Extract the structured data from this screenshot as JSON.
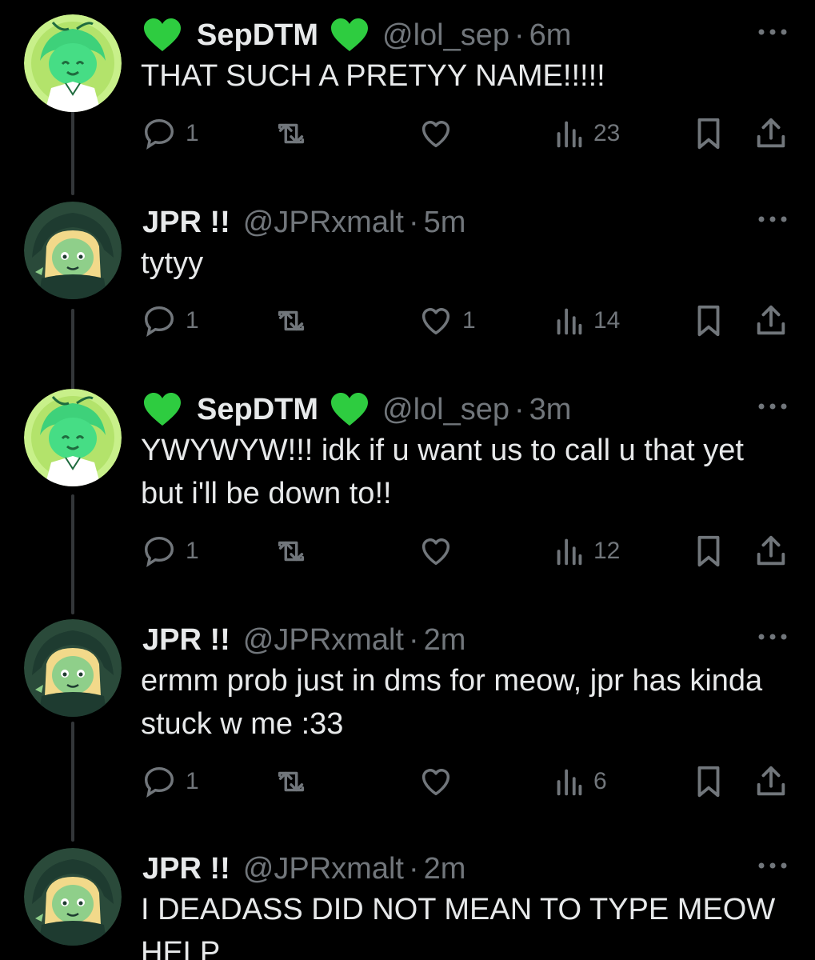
{
  "thread": {
    "tweets": [
      {
        "author": "SepDTM",
        "handle": "@lol_sep",
        "time": "6m",
        "text": "THAT SUCH A PRETYY NAME!!!!!",
        "avatar": "green-character-avatar",
        "name_emoji": "green-heart-icon",
        "replies": "1",
        "retweets": "",
        "likes": "",
        "views": "23"
      },
      {
        "author": "JPR !!",
        "handle": "@JPRxmalt",
        "time": "5m",
        "text": "tytyy",
        "avatar": "hooded-character-avatar",
        "replies": "1",
        "retweets": "",
        "likes": "1",
        "views": "14"
      },
      {
        "author": "SepDTM",
        "handle": "@lol_sep",
        "time": "3m",
        "text": "YWYWYW!!! idk if u want us to call u that yet but i'll be down to!!",
        "avatar": "green-character-avatar",
        "name_emoji": "green-heart-icon",
        "replies": "1",
        "retweets": "",
        "likes": "",
        "views": "12"
      },
      {
        "author": "JPR !!",
        "handle": "@JPRxmalt",
        "time": "2m",
        "text": "ermm prob just in dms for meow, jpr has kinda stuck w me :33",
        "avatar": "hooded-character-avatar",
        "replies": "1",
        "retweets": "",
        "likes": "",
        "views": "6"
      },
      {
        "author": "JPR !!",
        "handle": "@JPRxmalt",
        "time": "2m",
        "text": "I DEADASS DID NOT MEAN TO TYPE MEOW HELP",
        "avatar": "hooded-character-avatar"
      }
    ]
  },
  "colors": {
    "background": "#000000",
    "primary_text": "#e7e9ea",
    "secondary_text": "#71767b",
    "thread_line": "#333639",
    "heart_emoji": "#2ecc40",
    "avatar_green_bg": "#c8f08a",
    "avatar_dark_bg": "#2a4a3a"
  },
  "icons": [
    "reply-icon",
    "retweet-icon",
    "like-icon",
    "views-icon",
    "bookmark-icon",
    "share-icon",
    "more-icon"
  ]
}
